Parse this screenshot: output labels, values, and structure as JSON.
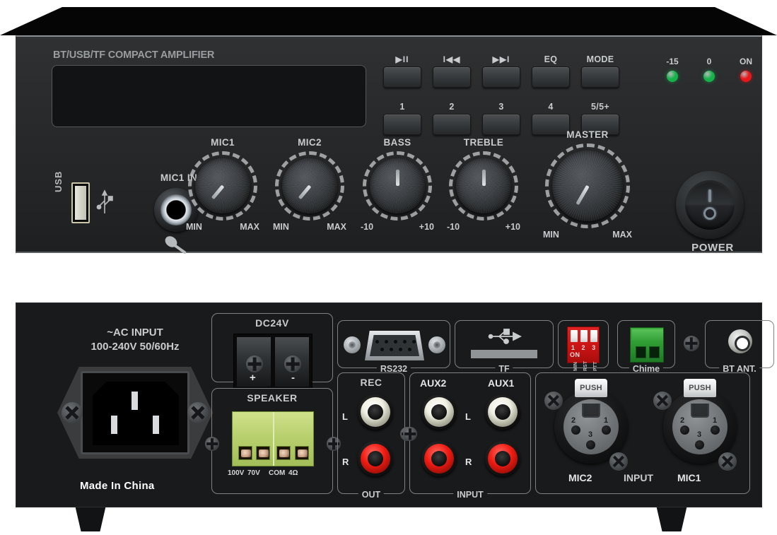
{
  "device": {
    "brand_text": "BT/USB/TF COMPACT AMPLIFIER",
    "made_in": "Made In China"
  },
  "front": {
    "transport_buttons": [
      {
        "label": "▶II",
        "name": "play-pause"
      },
      {
        "label": "I◀◀",
        "name": "previous"
      },
      {
        "label": "▶▶I",
        "name": "next"
      },
      {
        "label": "EQ",
        "name": "eq"
      },
      {
        "label": "MODE",
        "name": "mode"
      }
    ],
    "preset_buttons": [
      {
        "label": "1",
        "name": "preset-1"
      },
      {
        "label": "2",
        "name": "preset-2"
      },
      {
        "label": "3",
        "name": "preset-3"
      },
      {
        "label": "4",
        "name": "preset-4"
      },
      {
        "label": "5/5+",
        "name": "preset-5"
      }
    ],
    "leds": [
      {
        "label": "-15",
        "color": "#16b34a"
      },
      {
        "label": "0",
        "color": "#16b34a"
      },
      {
        "label": "ON",
        "color": "#e8171a"
      }
    ],
    "usb_label": "USB",
    "mic_in_label": "MIC1  IN",
    "knobs": [
      {
        "title": "MIC1",
        "min": "MIN",
        "max": "MAX",
        "angle": -140
      },
      {
        "title": "MIC2",
        "min": "MIN",
        "max": "MAX",
        "angle": -140
      },
      {
        "title": "BASS",
        "min": "-10",
        "max": "+10",
        "angle": 0
      },
      {
        "title": "TREBLE",
        "min": "-10",
        "max": "+10",
        "angle": 0
      }
    ],
    "master": {
      "title": "MASTER",
      "min": "MIN",
      "max": "MAX",
      "angle": -150
    },
    "power_label": "POWER"
  },
  "rear": {
    "ac_input": {
      "line1": "~AC INPUT",
      "line2": "100-240V  50/60Hz"
    },
    "dc24v": {
      "title": "DC24V",
      "plus": "+",
      "minus": "-"
    },
    "speaker": {
      "title": "SPEAKER",
      "terminals": [
        "100V",
        "70V",
        "COM",
        "4Ω"
      ]
    },
    "rs232": {
      "caption": "RS232"
    },
    "tf": {
      "caption": "TF"
    },
    "dip": {
      "numbers": [
        "1",
        "2",
        "3"
      ],
      "on": "ON",
      "sub": [
        "MIN",
        "RST",
        "PTT"
      ]
    },
    "chime": {
      "caption": "Chime"
    },
    "bt_ant": {
      "caption": "BT ANT."
    },
    "rec": {
      "title": "REC",
      "left": "L",
      "right": "R",
      "caption": "OUT"
    },
    "aux": {
      "aux2_title": "AUX2",
      "aux1_title": "AUX1",
      "left": "L",
      "right": "R",
      "caption": "INPUT"
    },
    "mic_inputs": {
      "push": "PUSH",
      "mic2": "MIC2",
      "center": "INPUT",
      "mic1": "MIC1",
      "pins": [
        "1",
        "2",
        "3"
      ]
    }
  }
}
